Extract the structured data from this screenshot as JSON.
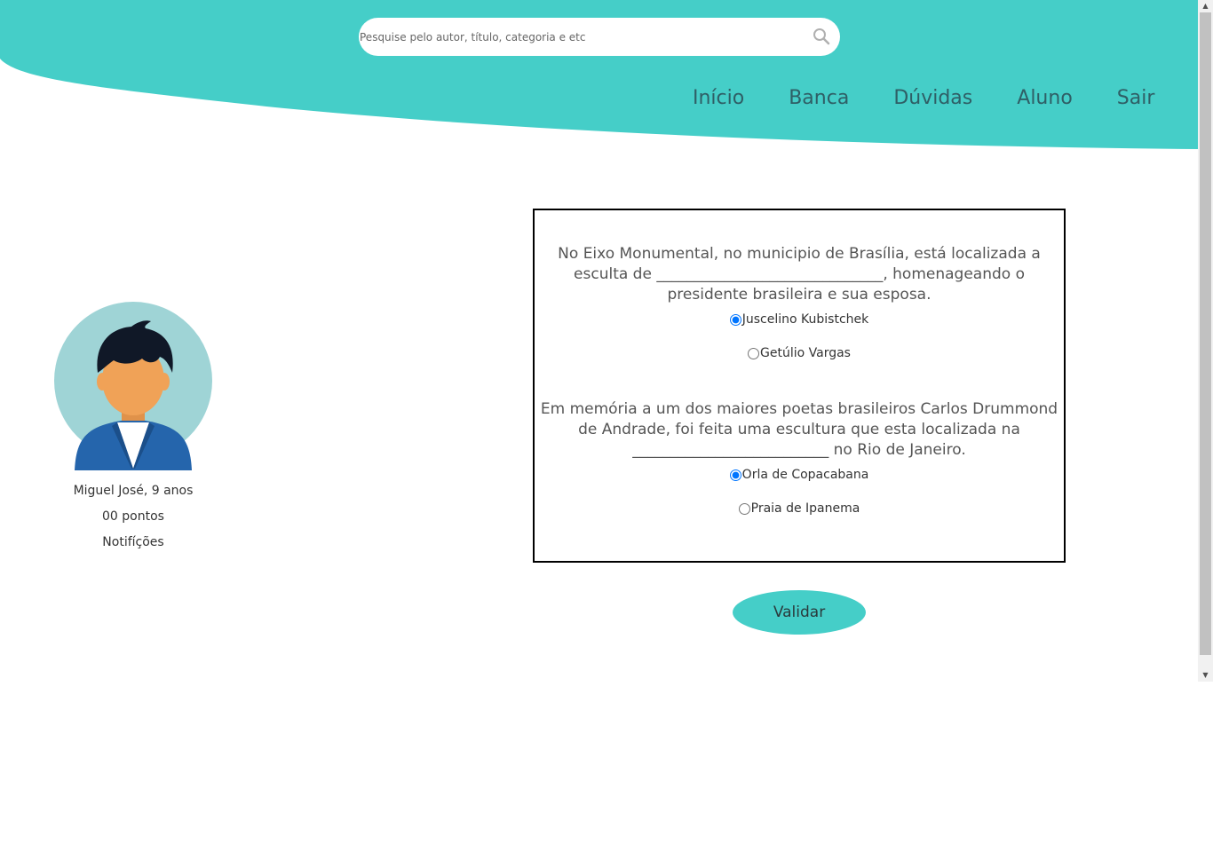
{
  "search": {
    "placeholder": "Pesquise pelo autor, título, categoria e etc",
    "value": ""
  },
  "nav": {
    "items": [
      {
        "label": "Início"
      },
      {
        "label": "Banca"
      },
      {
        "label": "Dúvidas"
      },
      {
        "label": "Aluno"
      },
      {
        "label": "Sair"
      }
    ]
  },
  "profile": {
    "name_age": "Miguel José, 9 anos",
    "points": "00 pontos",
    "notifications": "Notifíções"
  },
  "quiz": {
    "questions": [
      {
        "text": "No Eixo Monumental, no municipio de Brasília, está localizada a esculta de ______________________________, homenageando o presidente brasileira e sua esposa.",
        "options": [
          {
            "label": "Juscelino Kubistchek",
            "checked": true
          },
          {
            "label": "Getúlio Vargas",
            "checked": false
          }
        ]
      },
      {
        "text": "Em memória a um dos maiores poetas brasileiros Carlos Drummond de Andrade, foi feita uma escultura que esta localizada na __________________________ no Rio de Janeiro.",
        "options": [
          {
            "label": "Orla de Copacabana",
            "checked": true
          },
          {
            "label": "Praia de Ipanema",
            "checked": false
          }
        ]
      }
    ]
  },
  "validate_label": "Validar",
  "colors": {
    "header_teal": "#45cec8",
    "nav_text": "#2f5f66",
    "avatar_bg": "#9fd4d6",
    "jacket": "#2565ac",
    "skin": "#f0a257",
    "hair": "#101827"
  }
}
